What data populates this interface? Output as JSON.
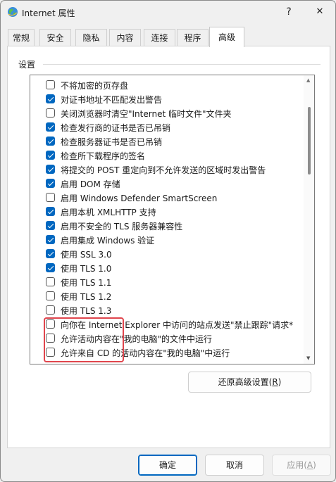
{
  "window": {
    "title": "Internet 属性",
    "help_label": "?",
    "close_label": "✕"
  },
  "tabs": [
    {
      "label": "常规",
      "active": false
    },
    {
      "label": "安全",
      "active": false
    },
    {
      "label": "隐私",
      "active": false
    },
    {
      "label": "内容",
      "active": false
    },
    {
      "label": "连接",
      "active": false
    },
    {
      "label": "程序",
      "active": false
    },
    {
      "label": "高级",
      "active": true
    }
  ],
  "settings": {
    "section_label": "设置",
    "items": [
      {
        "label": "不将加密的页存盘",
        "checked": false
      },
      {
        "label": "对证书地址不匹配发出警告",
        "checked": true
      },
      {
        "label": "关闭浏览器时清空\"Internet 临时文件\"文件夹",
        "checked": false
      },
      {
        "label": "检查发行商的证书是否已吊销",
        "checked": true
      },
      {
        "label": "检查服务器证书是否已吊销",
        "checked": true
      },
      {
        "label": "检查所下载程序的签名",
        "checked": true
      },
      {
        "label": "将提交的 POST 重定向到不允许发送的区域时发出警告",
        "checked": true
      },
      {
        "label": "启用 DOM 存储",
        "checked": true
      },
      {
        "label": "启用 Windows Defender SmartScreen",
        "checked": false
      },
      {
        "label": "启用本机 XMLHTTP 支持",
        "checked": true
      },
      {
        "label": "启用不安全的 TLS 服务器兼容性",
        "checked": true
      },
      {
        "label": "启用集成 Windows 验证",
        "checked": true
      },
      {
        "label": "使用 SSL 3.0",
        "checked": true
      },
      {
        "label": "使用 TLS 1.0",
        "checked": true
      },
      {
        "label": "使用 TLS 1.1",
        "checked": false
      },
      {
        "label": "使用 TLS 1.2",
        "checked": false
      },
      {
        "label": "使用 TLS 1.3",
        "checked": false
      },
      {
        "label": "向你在 Internet Explorer 中访问的站点发送\"禁止跟踪\"请求*",
        "checked": false
      },
      {
        "label": "允许活动内容在\"我的电脑\"的文件中运行",
        "checked": false
      },
      {
        "label": "允许来自 CD 的活动内容在\"我的电脑\"中运行",
        "checked": false
      }
    ],
    "restore_button": {
      "label": "还原高级设置(",
      "mnemonic": "R",
      "suffix": ")"
    }
  },
  "footer": {
    "ok_label": "确定",
    "cancel_label": "取消",
    "apply": {
      "label": "应用(",
      "mnemonic": "A",
      "suffix": ")"
    }
  },
  "colors": {
    "accent": "#0067c0",
    "highlight": "#e0454d"
  }
}
